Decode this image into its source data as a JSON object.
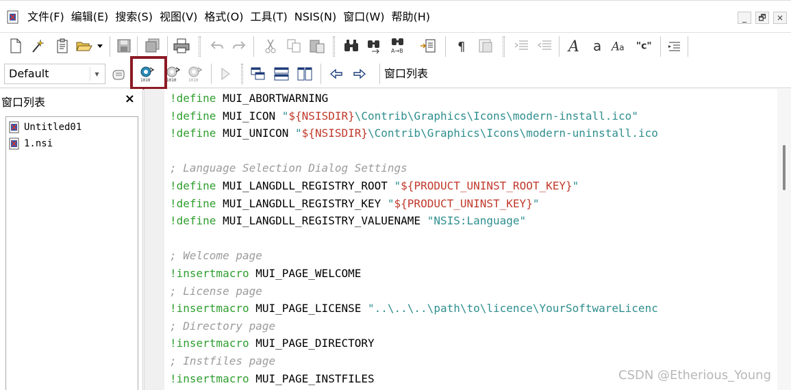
{
  "menubar": {
    "items": [
      "文件(F)",
      "编辑(E)",
      "搜索(S)",
      "视图(V)",
      "格式(O)",
      "工具(T)",
      "NSIS(N)",
      "窗口(W)",
      "帮助(H)"
    ],
    "window_buttons": [
      "_",
      "🗗",
      "×"
    ]
  },
  "toolbar2": {
    "style_combo_value": "Default",
    "window_list_label": "窗口列表"
  },
  "sidepanel": {
    "title": "窗口列表",
    "close_label": "×",
    "files": [
      "Untitled01",
      "1.nsi"
    ]
  },
  "editor": {
    "lines": [
      [
        {
          "t": "!define",
          "c": "kw"
        },
        {
          "t": " MUI_ABORTWARNING",
          "c": "plain"
        }
      ],
      [
        {
          "t": "!define",
          "c": "kw"
        },
        {
          "t": " MUI_ICON ",
          "c": "plain"
        },
        {
          "t": "\"",
          "c": "str"
        },
        {
          "t": "${NSISDIR}",
          "c": "var"
        },
        {
          "t": "\\Contrib\\Graphics\\Icons\\modern-install.ico\"",
          "c": "str"
        }
      ],
      [
        {
          "t": "!define",
          "c": "kw"
        },
        {
          "t": " MUI_UNICON ",
          "c": "plain"
        },
        {
          "t": "\"",
          "c": "str"
        },
        {
          "t": "${NSISDIR}",
          "c": "var"
        },
        {
          "t": "\\Contrib\\Graphics\\Icons\\modern-uninstall.ico",
          "c": "str"
        }
      ],
      [],
      [
        {
          "t": "; Language Selection Dialog Settings",
          "c": "comment"
        }
      ],
      [
        {
          "t": "!define",
          "c": "kw"
        },
        {
          "t": " MUI_LANGDLL_REGISTRY_ROOT ",
          "c": "plain"
        },
        {
          "t": "\"",
          "c": "str"
        },
        {
          "t": "${PRODUCT_UNINST_ROOT_KEY}",
          "c": "var"
        },
        {
          "t": "\"",
          "c": "str"
        }
      ],
      [
        {
          "t": "!define",
          "c": "kw"
        },
        {
          "t": " MUI_LANGDLL_REGISTRY_KEY ",
          "c": "plain"
        },
        {
          "t": "\"",
          "c": "str"
        },
        {
          "t": "${PRODUCT_UNINST_KEY}",
          "c": "var"
        },
        {
          "t": "\"",
          "c": "str"
        }
      ],
      [
        {
          "t": "!define",
          "c": "kw"
        },
        {
          "t": " MUI_LANGDLL_REGISTRY_VALUENAME ",
          "c": "plain"
        },
        {
          "t": "\"NSIS:Language\"",
          "c": "str"
        }
      ],
      [],
      [
        {
          "t": "; Welcome page",
          "c": "comment"
        }
      ],
      [
        {
          "t": "!insertmacro",
          "c": "kw"
        },
        {
          "t": " MUI_PAGE_WELCOME",
          "c": "plain"
        }
      ],
      [
        {
          "t": "; License page",
          "c": "comment"
        }
      ],
      [
        {
          "t": "!insertmacro",
          "c": "kw"
        },
        {
          "t": " MUI_PAGE_LICENSE ",
          "c": "plain"
        },
        {
          "t": "\"..\\..\\..\\path\\to\\licence\\YourSoftwareLicenc",
          "c": "str"
        }
      ],
      [
        {
          "t": "; Directory page",
          "c": "comment"
        }
      ],
      [
        {
          "t": "!insertmacro",
          "c": "kw"
        },
        {
          "t": " MUI_PAGE_DIRECTORY",
          "c": "plain"
        }
      ],
      [
        {
          "t": "; Instfiles page",
          "c": "comment"
        }
      ],
      [
        {
          "t": "!insertmacro",
          "c": "kw"
        },
        {
          "t": " MUI_PAGE_INSTFILES",
          "c": "plain"
        }
      ]
    ]
  },
  "watermark": "CSDN @Etherious_Young",
  "colors": {
    "keyword": "#2e9e2e",
    "comment": "#9b9b9b",
    "string": "#2f8e8e",
    "variable": "#c0392b",
    "highlight_box": "#8b1a24"
  }
}
